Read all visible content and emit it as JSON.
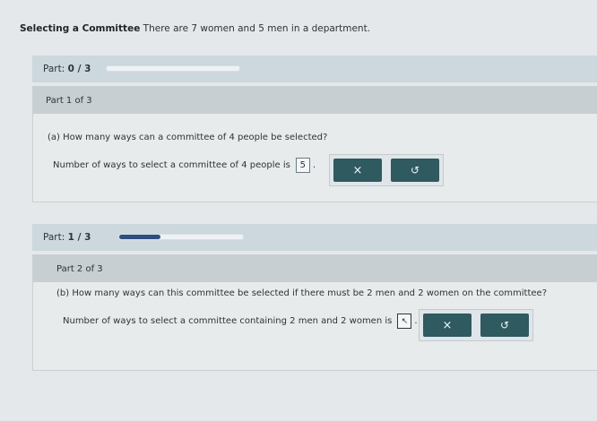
{
  "header": {
    "title": "Selecting a Committee",
    "text": "There are 7 women and 5 men in a department."
  },
  "parts": [
    {
      "progress_label": "Part:",
      "progress_value": "0 / 3",
      "progress_fraction": 0,
      "part_title": "Part 1 of 3",
      "question": "(a) How many ways can a committee of 4 people be selected?",
      "answer_prefix": "Number of ways to select a committee of 4 people is",
      "answer_value": "5",
      "answer_suffix": ".",
      "clear_label": "×",
      "undo_label": "↺"
    },
    {
      "progress_label": "Part:",
      "progress_value": "1 / 3",
      "progress_fraction": 0.333,
      "part_title": "Part 2 of 3",
      "question": "(b) How many ways can this committee be selected if there must be 2 men and 2 women on the committee?",
      "answer_prefix": "Number of ways to select a committee containing 2 men and 2 women is",
      "answer_value": "",
      "answer_suffix": ".",
      "clear_label": "×",
      "undo_label": "↺"
    }
  ],
  "colors": {
    "button": "#2e5a60",
    "progress_fill": "#2c4e80"
  }
}
